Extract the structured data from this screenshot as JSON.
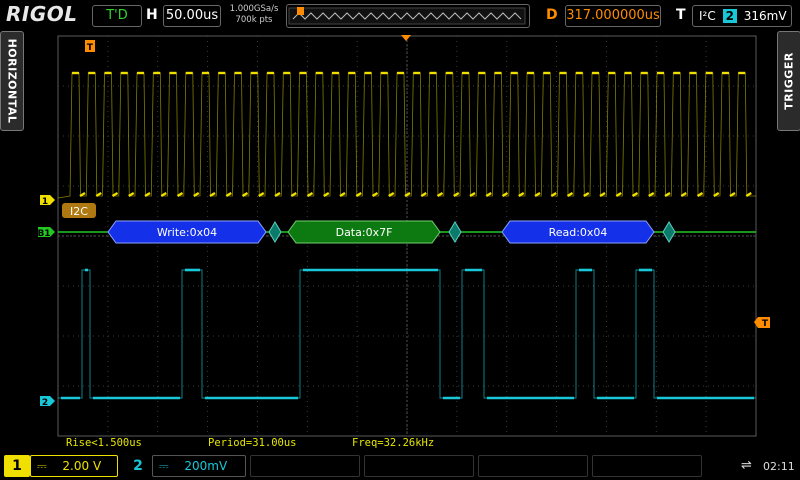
{
  "topbar": {
    "logo": "RIGOL",
    "status": "T'D",
    "timebase_letter": "H",
    "timebase": "50.00us",
    "sample_rate": "1.000GSa/s",
    "memory_depth": "700k pts",
    "delay_letter": "D",
    "delay": "317.000000us",
    "trigger_letter": "T",
    "trigger_type": "I²C",
    "trigger_source": "2",
    "trigger_level": "316mV"
  },
  "side": {
    "left_tab": "HORIZONTAL",
    "right_tab": "TRIGGER"
  },
  "markers": {
    "ch1": "1",
    "bus": "B1",
    "ch2": "2",
    "trigger_pos": "T",
    "trigger_level": "T",
    "bus_label": "I2C"
  },
  "decode": {
    "packets": [
      {
        "label": "Write:0x04",
        "color": "#1430e8",
        "border": "#8aa2ff"
      },
      {
        "label": "Data:0x7F",
        "color": "#0c7a10",
        "border": "#6fd06f"
      },
      {
        "label": "Read:0x04",
        "color": "#1430e8",
        "border": "#8aa2ff"
      }
    ]
  },
  "measurements": {
    "rise": "Rise<1.500us",
    "period": "Period=31.00us",
    "freq": "Freq=32.26kHz"
  },
  "bottombar": {
    "ch1_num": "1",
    "ch1_coupling": "⎓",
    "ch1_scale": "2.00 V",
    "ch2_num": "2",
    "ch2_coupling": "⎓",
    "ch2_scale": "200mV",
    "usb_icon": "usb-icon",
    "time": "02:11"
  },
  "colors": {
    "ch1": "#f0e000",
    "ch2": "#18c8d8",
    "bus": "#23c823",
    "accent": "#ff8c00"
  }
}
